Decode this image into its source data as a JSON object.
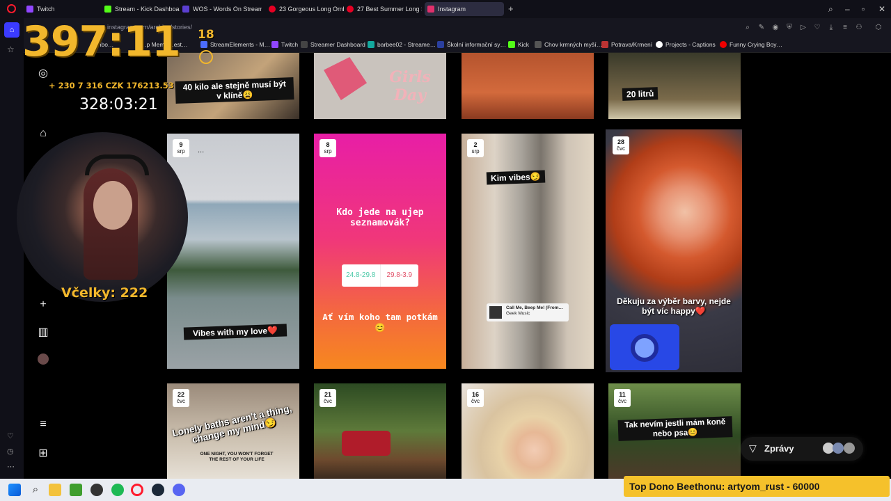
{
  "tabs": [
    {
      "label": "Twitch",
      "color": "#9146ff"
    },
    {
      "label": "Stream - Kick Dashboard",
      "color": "#53fc18"
    },
    {
      "label": "WOS - Words On Stream",
      "color": "#5b3fd0"
    },
    {
      "label": "23 Gorgeous Long Ombre",
      "color": "#e60023"
    },
    {
      "label": "27 Best Summer Long Stra",
      "color": "#e60023"
    },
    {
      "label": "Instagram",
      "color": "#e1306c"
    }
  ],
  "address": {
    "url": "instagram.com/archive/stories/"
  },
  "bookmarks": [
    "…shbo…",
    "…p Meme…est…",
    "StreamElements - M…",
    "Twitch",
    "Streamer Dashboard",
    "barbee02 - Streame…",
    "Školní informační sy…",
    "Kick",
    "Chov krmných myší…",
    "Potrava/Krmení",
    "Projects - Captions",
    "Funny Crying Boy…"
  ],
  "overlay": {
    "big_timer": "397:11",
    "small_num": "18",
    "stats": "+ 230   7 316   CZK 176213.53",
    "subtimer": "328:03:21",
    "bees_label": "Včelky:",
    "bees_value": "222"
  },
  "stories_row1": [
    {
      "caption": "40 kilo ale stejně musí být v klíně😩"
    },
    {
      "caption": "Girls Day"
    },
    {
      "caption": ""
    },
    {
      "caption": "20 litrů"
    }
  ],
  "stories_row2": [
    {
      "day": "9",
      "month": "srp",
      "caption": "Vibes with my love❤️",
      "extra": "..."
    },
    {
      "day": "8",
      "month": "srp",
      "caption_top": "Kdo jede na ujep seznamovák?",
      "opt1": "24.8-29.8",
      "opt2": "29.8-3.9",
      "caption_bottom": "Ať vím koho tam potkám 😊"
    },
    {
      "day": "2",
      "month": "srp",
      "caption": "Kim vibes😏",
      "music_title": "Call Me, Beep Me! (From…",
      "music_artist": "Geek Music"
    },
    {
      "day": "28",
      "month": "čvc",
      "caption": "Děkuju za výběr barvy, nejde být víc happy❤️"
    }
  ],
  "stories_row3": [
    {
      "day": "22",
      "month": "čvc",
      "caption": "Lonely baths aren't a thing, change my mind😏",
      "book": "ONE NIGHT, YOU WON'T FORGET THE REST OF YOUR LIFE"
    },
    {
      "day": "21",
      "month": "čvc",
      "caption": ""
    },
    {
      "day": "16",
      "month": "čvc",
      "caption": ""
    },
    {
      "day": "11",
      "month": "čvc",
      "caption": "Tak nevím jestli mám koně nebo psa😊"
    }
  ],
  "messages_button": "Zprávy",
  "dono_banner": "Top Dono Beethonu: artyom_rust - 60000"
}
